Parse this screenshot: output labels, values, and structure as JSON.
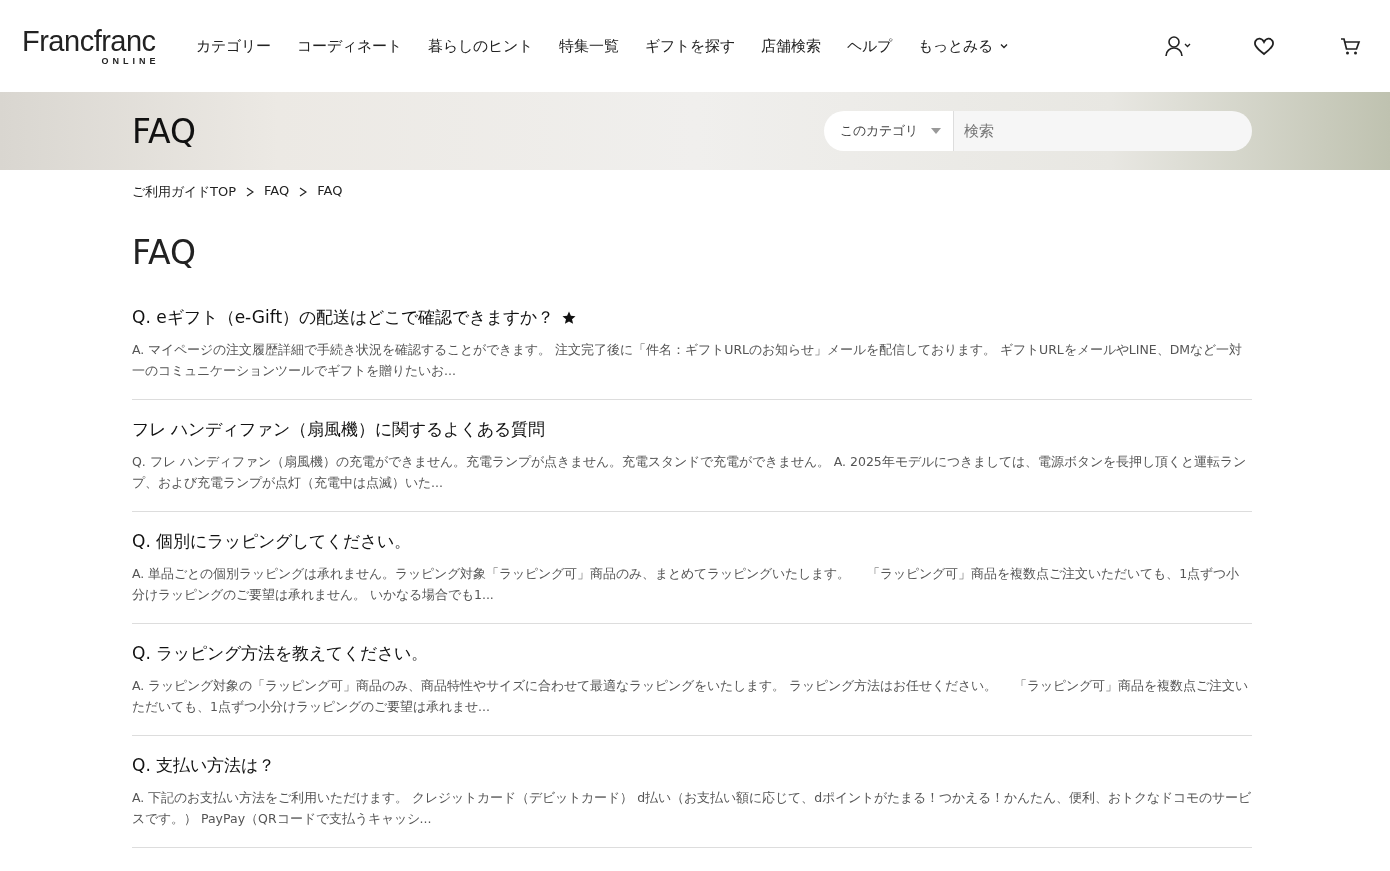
{
  "header": {
    "logo": "Francfranc",
    "logo_sub": "ONLINE",
    "nav": [
      {
        "label": "カテゴリー",
        "has_menu": false
      },
      {
        "label": "コーディネート",
        "has_menu": false
      },
      {
        "label": "暮らしのヒント",
        "has_menu": false
      },
      {
        "label": "特集一覧",
        "has_menu": false
      },
      {
        "label": "ギフトを探す",
        "has_menu": false
      },
      {
        "label": "店舗検索",
        "has_menu": false
      },
      {
        "label": "ヘルプ",
        "has_menu": false
      },
      {
        "label": "もっとみる",
        "has_menu": true
      }
    ]
  },
  "banner": {
    "title": "FAQ",
    "search": {
      "scope": "このカテゴリ",
      "placeholder": "検索"
    }
  },
  "breadcrumb": [
    "ご利用ガイドTOP",
    "FAQ",
    "FAQ"
  ],
  "page_title": "FAQ",
  "faqs": [
    {
      "question": "Q. eギフト（e-Gift）の配送はどこで確認できますか？",
      "starred": true,
      "answer": "A. マイページの注文履歴詳細で手続き状況を確認することができます。 注文完了後に「件名：ギフトURLのお知らせ」メールを配信しております。 ギフトURLをメールやLINE、DMなど一対一のコミュニケーションツールでギフトを贈りたいお..."
    },
    {
      "question": "フレ ハンディファン（扇風機）に関するよくある質問",
      "starred": false,
      "answer": "Q. フレ ハンディファン（扇風機）の充電ができません。充電ランプが点きません。充電スタンドで充電ができません。 A. 2025年モデルにつきましては、電源ボタンを長押し頂くと運転ランプ、および充電ランプが点灯（充電中は点滅）いた..."
    },
    {
      "question": "Q. 個別にラッピングしてください。",
      "starred": false,
      "answer": "A. 単品ごとの個別ラッピングは承れません。ラッピング対象「ラッピング可」商品のみ、まとめてラッピングいたします。　 「ラッピング可」商品を複数点ご注文いただいても、1点ずつ小分けラッピングのご要望は承れません。 いかなる場合でも1..."
    },
    {
      "question": "Q. ラッピング方法を教えてください。",
      "starred": false,
      "answer": "A. ラッピング対象の「ラッピング可」商品のみ、商品特性やサイズに合わせて最適なラッピングをいたします。 ラッピング方法はお任せください。　 「ラッピング可」商品を複数点ご注文いただいても、1点ずつ小分けラッピングのご要望は承れませ..."
    },
    {
      "question": "Q. 支払い方法は？",
      "starred": false,
      "answer": "A. 下記のお支払い方法をご利用いただけます。 クレジットカード（デビットカード） d払い（お支払い額に応じて、dポイントがたまる！つかえる！かんたん、便利、おトクなドコモのサービスです。） PayPay（QRコードで支払うキャッシ..."
    }
  ]
}
